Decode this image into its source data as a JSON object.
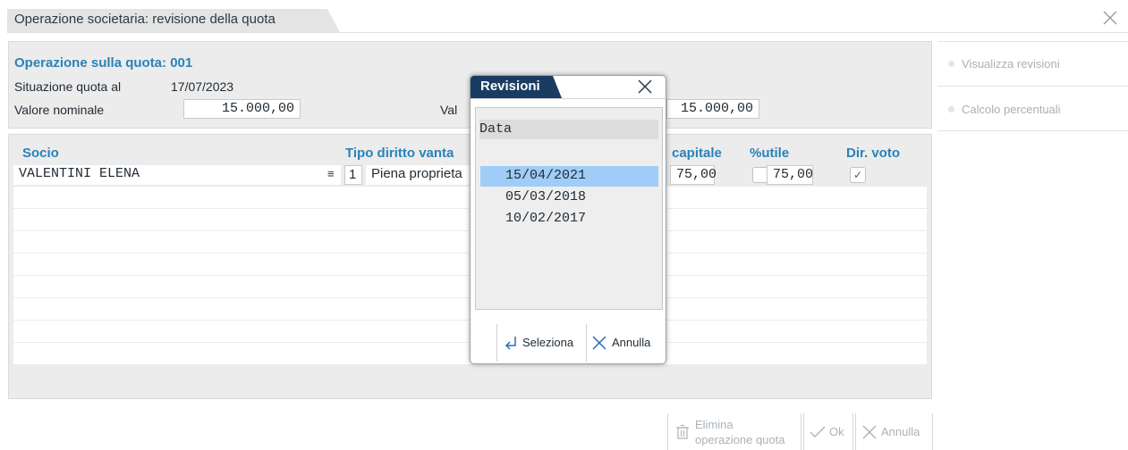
{
  "window": {
    "title": "Operazione societaria: revisione della quota",
    "close_icon": "close-icon"
  },
  "header": {
    "operation_title": "Operazione sulla quota: 001",
    "situation_label": "Situazione quota al",
    "situation_date": "17/07/2023",
    "nominal_label": "Valore nominale",
    "nominal_value": "15.000,00",
    "second_label_partial": "Val",
    "second_value": "15.000,00"
  },
  "grid": {
    "columns": [
      "Socio",
      "Tipo diritto vanta",
      "capitale",
      "%utile",
      "Dir. voto"
    ],
    "rows": [
      {
        "socio": "VALENTINI ELENA",
        "menu_glyph": "≡",
        "tipo_code": "1",
        "tipo_desc": "Piena proprieta",
        "capitale": "75,00",
        "utile": "75,00",
        "dir_voto": "✓"
      }
    ]
  },
  "side_actions": [
    {
      "label": "Visualizza revisioni",
      "icon": "dot-icon"
    },
    {
      "label": "Calcolo percentuali",
      "icon": "dot-icon"
    }
  ],
  "bottom_actions": {
    "delete_line1": "Elimina",
    "delete_line2": "operazione quota",
    "ok": "Ok",
    "cancel": "Annulla"
  },
  "modal": {
    "title": "Revisioni",
    "list_header": "Data",
    "dates": [
      "15/04/2021",
      "05/03/2018",
      "10/02/2017"
    ],
    "selected_index": 0,
    "select_label": "Seleziona",
    "cancel_label": "Annulla"
  },
  "colors": {
    "accent_blue": "#2a82b8",
    "modal_title_bg": "#1a3c63",
    "selection_bg": "#9fcdf7"
  }
}
